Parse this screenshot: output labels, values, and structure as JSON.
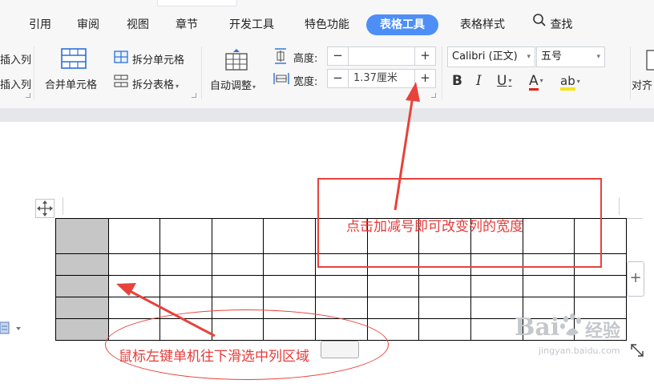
{
  "ribbon": {
    "tabs": [
      {
        "label": "引用"
      },
      {
        "label": "审阅"
      },
      {
        "label": "视图"
      },
      {
        "label": "章节"
      },
      {
        "label": "开发工具"
      },
      {
        "label": "特色功能"
      },
      {
        "label": "表格工具",
        "active": true
      },
      {
        "label": "表格样式"
      }
    ],
    "search_label": "查找",
    "insert_col_left": "插入列",
    "insert_col_right": "插入列",
    "merge_cells": "合并单元格",
    "split_cells": "拆分单元格",
    "split_table": "拆分表格",
    "auto_fit": "自动调整",
    "height_label": "高度:",
    "height_value": "",
    "width_label": "宽度:",
    "width_value": "1.37厘米",
    "font_name": "Calibri (正文)",
    "font_size": "五号",
    "align_label": "对齐",
    "accent_color": "#4e8ef7"
  },
  "annotations": {
    "box_text": "点击加减号即可改变列的宽度",
    "ellipse_text": "鼠标左键单机往下滑选中列区域",
    "color": "#e8423c"
  },
  "table": {
    "rows": 5,
    "cols": 11,
    "selected_col": 0
  },
  "watermark": {
    "line1": "Bai",
    "line2": "经验",
    "line3": "jingyan.baidu.com"
  }
}
